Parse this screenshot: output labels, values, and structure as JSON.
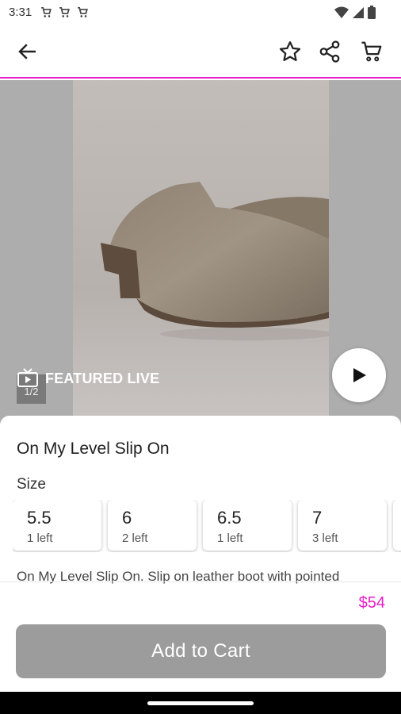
{
  "status_bar": {
    "time": "3:31"
  },
  "colors": {
    "accent": "#e91ec8",
    "button_disabled": "#9c9c9c"
  },
  "icons": {
    "back": "back-arrow-icon",
    "favorite": "star-outline-icon",
    "share": "share-icon",
    "cart": "cart-icon",
    "live": "tv-icon",
    "play": "play-icon"
  },
  "media": {
    "featured_label": "FEATURED LIVE",
    "page_indicator": "1/2"
  },
  "product": {
    "title": "On My Level Slip On",
    "size_label": "Size",
    "sizes": [
      {
        "value": "5.5",
        "stock": "1 left"
      },
      {
        "value": "6",
        "stock": "2 left"
      },
      {
        "value": "6.5",
        "stock": "1 left"
      },
      {
        "value": "7",
        "stock": "3 left"
      }
    ],
    "description": "On My Level Slip On. Slip on leather boot with pointed",
    "price": "$54",
    "add_to_cart": "Add to Cart"
  }
}
